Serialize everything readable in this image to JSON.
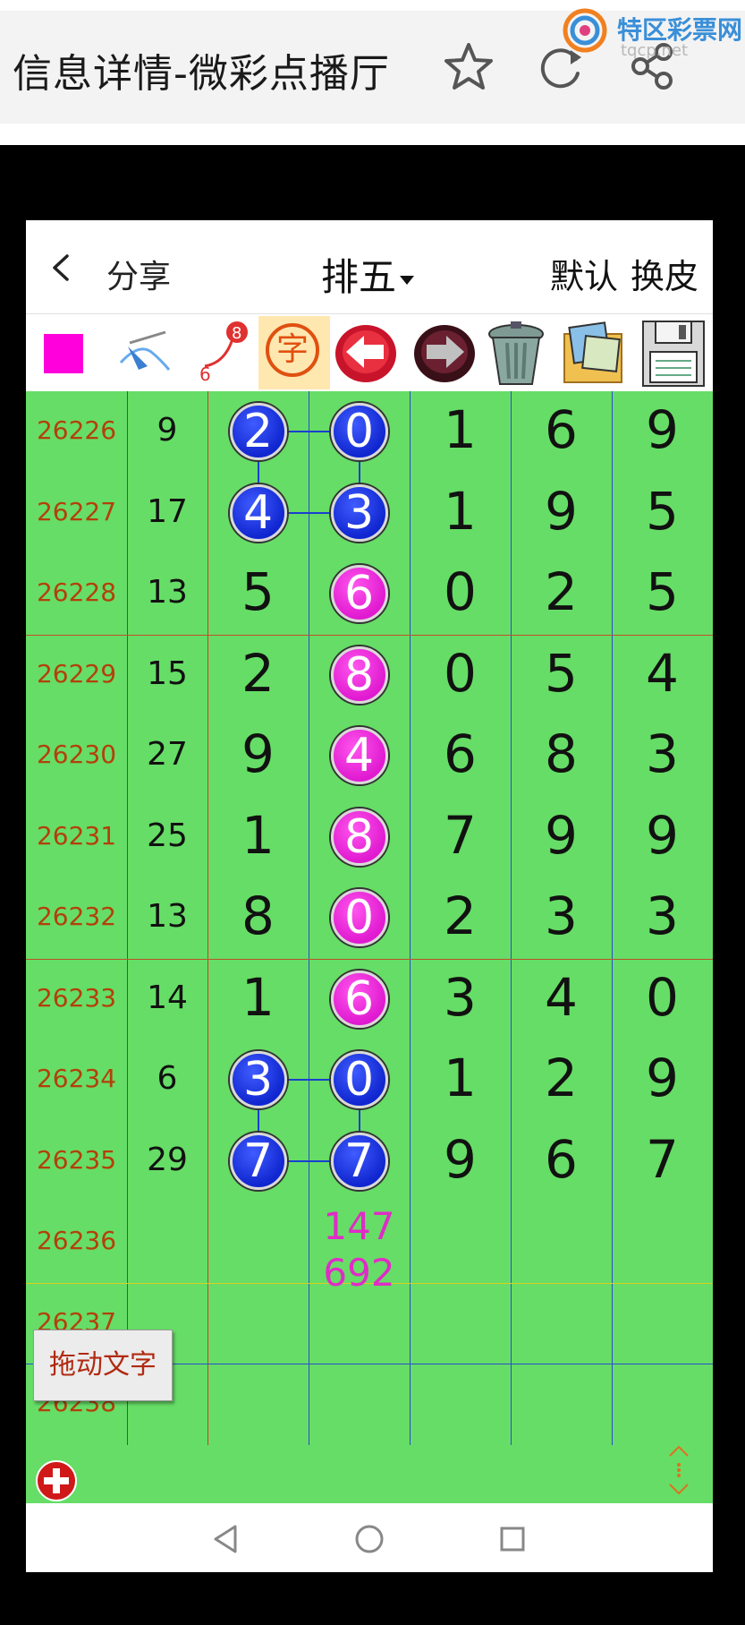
{
  "topbar": {
    "title": "信息详情-微彩点播厅"
  },
  "watermark": {
    "text": "特区彩票网",
    "url": "tqcp.net"
  },
  "header": {
    "share_label": "分享",
    "lottery_name": "排五",
    "default_label": "默认",
    "skin_label": "换皮"
  },
  "toolbar": {
    "tools": [
      "color-swatch",
      "pen-icon",
      "connect-dots-icon",
      "text-tool-icon",
      "undo-arrow-icon",
      "redo-arrow-icon",
      "trash-icon",
      "image-album-icon",
      "save-disk-icon"
    ],
    "connect_numbers": [
      "8",
      "6"
    ],
    "text_tool_char": "字",
    "swatch_color": "#ff00dd"
  },
  "rows": [
    {
      "period": "26226",
      "sum": "9",
      "digits": [
        "2",
        "0",
        "1",
        "6",
        "9"
      ]
    },
    {
      "period": "26227",
      "sum": "17",
      "digits": [
        "4",
        "3",
        "1",
        "9",
        "5"
      ]
    },
    {
      "period": "26228",
      "sum": "13",
      "digits": [
        "5",
        "6",
        "0",
        "2",
        "5"
      ]
    },
    {
      "period": "26229",
      "sum": "15",
      "digits": [
        "2",
        "8",
        "0",
        "5",
        "4"
      ]
    },
    {
      "period": "26230",
      "sum": "27",
      "digits": [
        "9",
        "4",
        "6",
        "8",
        "3"
      ]
    },
    {
      "period": "26231",
      "sum": "25",
      "digits": [
        "1",
        "8",
        "7",
        "9",
        "9"
      ]
    },
    {
      "period": "26232",
      "sum": "13",
      "digits": [
        "8",
        "0",
        "2",
        "3",
        "3"
      ]
    },
    {
      "period": "26233",
      "sum": "14",
      "digits": [
        "1",
        "6",
        "3",
        "4",
        "0"
      ]
    },
    {
      "period": "26234",
      "sum": "6",
      "digits": [
        "3",
        "0",
        "1",
        "2",
        "9"
      ]
    },
    {
      "period": "26235",
      "sum": "29",
      "digits": [
        "7",
        "7",
        "9",
        "6",
        "7"
      ]
    },
    {
      "period": "26236",
      "sum": "",
      "digits": [
        "",
        "",
        "",
        "",
        ""
      ]
    },
    {
      "period": "26237",
      "sum": "",
      "digits": [
        "",
        "",
        "",
        "",
        ""
      ]
    },
    {
      "period": "26238",
      "sum": "",
      "digits": [
        "",
        "",
        "",
        "",
        ""
      ]
    }
  ],
  "balls": [
    {
      "row": 0,
      "col": 0,
      "color": "blue"
    },
    {
      "row": 0,
      "col": 1,
      "color": "blue"
    },
    {
      "row": 1,
      "col": 0,
      "color": "blue"
    },
    {
      "row": 1,
      "col": 1,
      "color": "blue"
    },
    {
      "row": 2,
      "col": 1,
      "color": "pink"
    },
    {
      "row": 3,
      "col": 1,
      "color": "pink"
    },
    {
      "row": 4,
      "col": 1,
      "color": "pink"
    },
    {
      "row": 5,
      "col": 1,
      "color": "pink"
    },
    {
      "row": 6,
      "col": 1,
      "color": "pink"
    },
    {
      "row": 7,
      "col": 1,
      "color": "pink"
    },
    {
      "row": 8,
      "col": 0,
      "color": "blue"
    },
    {
      "row": 8,
      "col": 1,
      "color": "blue"
    },
    {
      "row": 9,
      "col": 0,
      "color": "blue"
    },
    {
      "row": 9,
      "col": 1,
      "color": "blue"
    }
  ],
  "prediction": {
    "line1": "147",
    "line2": "692"
  },
  "drag_text_label": "拖动文字",
  "colors": {
    "grid_green": "#66dd66",
    "ball_blue": "#1026d0",
    "ball_pink": "#e01ad0",
    "period_text": "#b3400a",
    "prediction_text": "#e02bc8"
  }
}
